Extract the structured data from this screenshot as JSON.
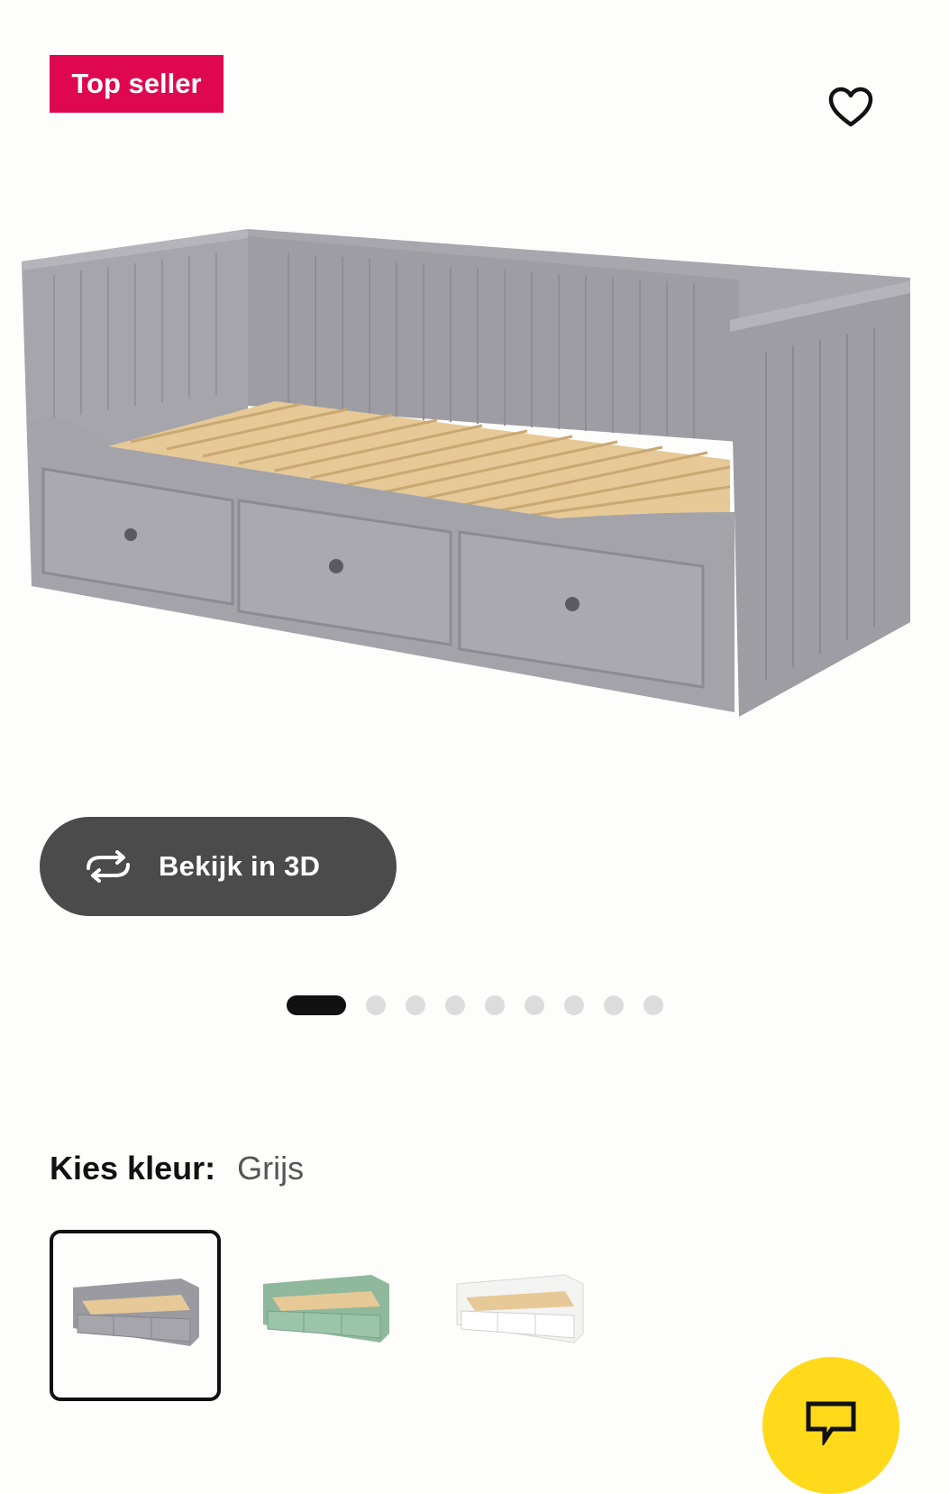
{
  "badge": {
    "label": "Top seller",
    "color": "#e00751"
  },
  "favorite": {
    "icon": "heart-outline-icon"
  },
  "product": {
    "image": "grey-daybed-with-3-drawers"
  },
  "view3d": {
    "label": "Bekijk in 3D",
    "icon": "rotate-3d-icon"
  },
  "carousel": {
    "count": 9,
    "active": 0
  },
  "color_picker": {
    "label": "Kies kleur:",
    "selected": "Grijs",
    "swatches": [
      {
        "name": "grey",
        "color": "#9a9aa0",
        "selected": true
      },
      {
        "name": "green",
        "color": "#8fb89c",
        "selected": false
      },
      {
        "name": "white",
        "color": "#f3f3f1",
        "selected": false
      }
    ]
  },
  "chat": {
    "icon": "chat-bubble-icon",
    "color": "#ffda1a"
  }
}
